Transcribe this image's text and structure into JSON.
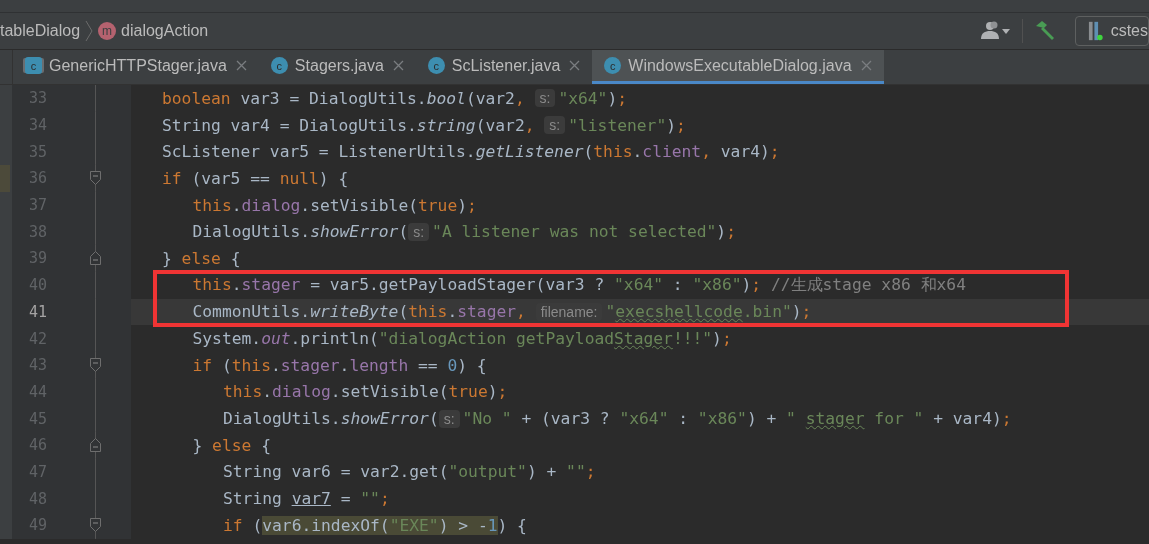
{
  "breadcrumb": {
    "items": [
      {
        "text": "tableDialog"
      },
      {
        "text": "dialogAction",
        "icon_letter": "m"
      }
    ]
  },
  "toolbar": {
    "run_config": "cstes"
  },
  "tabs": [
    {
      "label": "GenericHTTPStager.java",
      "icon_letter": "c",
      "kind": "decompiled",
      "selected": false
    },
    {
      "label": "Stagers.java",
      "icon_letter": "c",
      "kind": "class",
      "selected": false
    },
    {
      "label": "ScListener.java",
      "icon_letter": "c",
      "kind": "class",
      "selected": false
    },
    {
      "label": "WindowsExecutableDialog.java",
      "icon_letter": "c",
      "kind": "class",
      "selected": true
    }
  ],
  "editor": {
    "lines": [
      {
        "number": "33",
        "fold_start": false,
        "fold_end": false,
        "boxed": false,
        "current": false,
        "marker": false,
        "t": [
          {
            "kind": "kw",
            "text": "boolean"
          },
          {
            "kind": "p",
            "text": " var3 = DialogUtils."
          },
          {
            "kind": "it",
            "text": "bool"
          },
          {
            "kind": "p",
            "text": "(var2"
          },
          {
            "kind": "kw",
            "text": ", "
          },
          {
            "kind": "hint",
            "text": "s:"
          },
          {
            "kind": "str",
            "text": "\"x64\""
          },
          {
            "kind": "p",
            "text": ")"
          },
          {
            "kind": "kw",
            "text": ";"
          }
        ]
      },
      {
        "number": "34",
        "fold_start": false,
        "fold_end": false,
        "boxed": false,
        "current": false,
        "marker": false,
        "t": [
          {
            "kind": "p",
            "text": "String var4 = DialogUtils."
          },
          {
            "kind": "it",
            "text": "string"
          },
          {
            "kind": "p",
            "text": "(var2"
          },
          {
            "kind": "kw",
            "text": ", "
          },
          {
            "kind": "hint",
            "text": "s:"
          },
          {
            "kind": "str",
            "text": "\"listener\""
          },
          {
            "kind": "p",
            "text": ")"
          },
          {
            "kind": "kw",
            "text": ";"
          }
        ]
      },
      {
        "number": "35",
        "fold_start": false,
        "fold_end": false,
        "boxed": false,
        "current": false,
        "marker": false,
        "t": [
          {
            "kind": "p",
            "text": "ScListener var5 = ListenerUtils."
          },
          {
            "kind": "it",
            "text": "getListener"
          },
          {
            "kind": "p",
            "text": "("
          },
          {
            "kind": "kw",
            "text": "this"
          },
          {
            "kind": "p",
            "text": "."
          },
          {
            "kind": "f",
            "text": "client"
          },
          {
            "kind": "kw",
            "text": ", "
          },
          {
            "kind": "p",
            "text": "var4)"
          },
          {
            "kind": "kw",
            "text": ";"
          }
        ]
      },
      {
        "number": "36",
        "fold_start": true,
        "fold_end": false,
        "boxed": false,
        "current": false,
        "marker": true,
        "t": [
          {
            "kind": "kw",
            "text": "if"
          },
          {
            "kind": "p",
            "text": " (var5 == "
          },
          {
            "kind": "kw",
            "text": "null"
          },
          {
            "kind": "p",
            "text": ") {"
          }
        ],
        "children": [
          {
            "number": "37",
            "fold_start": false,
            "fold_end": false,
            "boxed": false,
            "current": false,
            "marker": false,
            "t": [
              {
                "kind": "kw",
                "text": "this"
              },
              {
                "kind": "p",
                "text": "."
              },
              {
                "kind": "f",
                "text": "dialog"
              },
              {
                "kind": "p",
                "text": ".setVisible("
              },
              {
                "kind": "kw",
                "text": "true"
              },
              {
                "kind": "p",
                "text": ")"
              },
              {
                "kind": "kw",
                "text": ";"
              }
            ]
          },
          {
            "number": "38",
            "fold_start": false,
            "fold_end": false,
            "boxed": false,
            "current": false,
            "marker": false,
            "t": [
              {
                "kind": "p",
                "text": "DialogUtils."
              },
              {
                "kind": "it",
                "text": "showError"
              },
              {
                "kind": "p",
                "text": "("
              },
              {
                "kind": "hint",
                "text": "s:"
              },
              {
                "kind": "str",
                "text": "\"A listener was not selected\""
              },
              {
                "kind": "p",
                "text": ")"
              },
              {
                "kind": "kw",
                "text": ";"
              }
            ]
          }
        ]
      },
      {
        "number": "39",
        "fold_start": false,
        "fold_end": true,
        "boxed": false,
        "current": false,
        "marker": false,
        "t": [
          {
            "kind": "p",
            "text": "} "
          },
          {
            "kind": "kw",
            "text": "else"
          },
          {
            "kind": "p",
            "text": " {"
          }
        ],
        "children": [
          {
            "number": "40",
            "fold_start": false,
            "fold_end": false,
            "boxed": true,
            "current": false,
            "marker": false,
            "t": [
              {
                "kind": "kw",
                "text": "this"
              },
              {
                "kind": "p",
                "text": "."
              },
              {
                "kind": "f",
                "text": "stager"
              },
              {
                "kind": "p",
                "text": " = var5.getPayloadStager(var3 ? "
              },
              {
                "kind": "str",
                "text": "\"x64\""
              },
              {
                "kind": "p",
                "text": " : "
              },
              {
                "kind": "str",
                "text": "\"x86\""
              },
              {
                "kind": "p",
                "text": ")"
              },
              {
                "kind": "kw",
                "text": ";"
              },
              {
                "kind": "cm",
                "text": " //生成stage x86 和x64"
              }
            ]
          },
          {
            "number": "41",
            "fold_start": false,
            "fold_end": false,
            "boxed": true,
            "current": true,
            "marker": false,
            "t": [
              {
                "kind": "p",
                "text": "CommonUtils."
              },
              {
                "kind": "it",
                "text": "writeByte"
              },
              {
                "kind": "p",
                "text": "("
              },
              {
                "kind": "kw",
                "text": "this"
              },
              {
                "kind": "p",
                "text": "."
              },
              {
                "kind": "f",
                "text": "stager"
              },
              {
                "kind": "kw",
                "text": ", "
              },
              {
                "kind": "hint",
                "text": "filename:"
              },
              {
                "kind": "str",
                "text": "\""
              },
              {
                "kind": "sw",
                "text": "execshellcode"
              },
              {
                "kind": "str",
                "text": ".bin\""
              },
              {
                "kind": "p",
                "text": ")"
              },
              {
                "kind": "kw",
                "text": ";"
              }
            ]
          },
          {
            "number": "42",
            "fold_start": false,
            "fold_end": false,
            "boxed": false,
            "current": false,
            "marker": false,
            "t": [
              {
                "kind": "p",
                "text": "System."
              },
              {
                "kind": "st",
                "text": "out"
              },
              {
                "kind": "p",
                "text": ".println("
              },
              {
                "kind": "str",
                "text": "\"dialogAction getPayload"
              },
              {
                "kind": "sw",
                "text": "Stager"
              },
              {
                "kind": "str",
                "text": "!!!\""
              },
              {
                "kind": "p",
                "text": ")"
              },
              {
                "kind": "kw",
                "text": ";"
              }
            ]
          },
          {
            "number": "43",
            "fold_start": true,
            "fold_end": false,
            "boxed": false,
            "current": false,
            "marker": false,
            "t": [
              {
                "kind": "kw",
                "text": "if"
              },
              {
                "kind": "p",
                "text": " ("
              },
              {
                "kind": "kw",
                "text": "this"
              },
              {
                "kind": "p",
                "text": "."
              },
              {
                "kind": "f",
                "text": "stager"
              },
              {
                "kind": "p",
                "text": "."
              },
              {
                "kind": "f",
                "text": "length"
              },
              {
                "kind": "p",
                "text": " == "
              },
              {
                "kind": "n",
                "text": "0"
              },
              {
                "kind": "p",
                "text": ") {"
              }
            ],
            "children": [
              {
                "number": "44",
                "fold_start": false,
                "fold_end": false,
                "boxed": false,
                "current": false,
                "marker": false,
                "t": [
                  {
                    "kind": "kw",
                    "text": "this"
                  },
                  {
                    "kind": "p",
                    "text": "."
                  },
                  {
                    "kind": "f",
                    "text": "dialog"
                  },
                  {
                    "kind": "p",
                    "text": ".setVisible("
                  },
                  {
                    "kind": "kw",
                    "text": "true"
                  },
                  {
                    "kind": "p",
                    "text": ")"
                  },
                  {
                    "kind": "kw",
                    "text": ";"
                  }
                ]
              },
              {
                "number": "45",
                "fold_start": false,
                "fold_end": false,
                "boxed": false,
                "current": false,
                "marker": false,
                "t": [
                  {
                    "kind": "p",
                    "text": "DialogUtils."
                  },
                  {
                    "kind": "it",
                    "text": "showError"
                  },
                  {
                    "kind": "p",
                    "text": "("
                  },
                  {
                    "kind": "hint",
                    "text": "s:"
                  },
                  {
                    "kind": "str",
                    "text": "\"No \""
                  },
                  {
                    "kind": "p",
                    "text": " + (var3 ? "
                  },
                  {
                    "kind": "str",
                    "text": "\"x64\""
                  },
                  {
                    "kind": "p",
                    "text": " : "
                  },
                  {
                    "kind": "str",
                    "text": "\"x86\""
                  },
                  {
                    "kind": "p",
                    "text": ") + "
                  },
                  {
                    "kind": "str",
                    "text": "\" "
                  },
                  {
                    "kind": "sw",
                    "text": "stager"
                  },
                  {
                    "kind": "str",
                    "text": " for \""
                  },
                  {
                    "kind": "p",
                    "text": " + var4)"
                  },
                  {
                    "kind": "kw",
                    "text": ";"
                  }
                ]
              }
            ]
          },
          {
            "number": "46",
            "fold_start": false,
            "fold_end": true,
            "boxed": false,
            "current": false,
            "marker": false,
            "t": [
              {
                "kind": "p",
                "text": "} "
              },
              {
                "kind": "kw",
                "text": "else"
              },
              {
                "kind": "p",
                "text": " {"
              }
            ],
            "children": [
              {
                "number": "47",
                "fold_start": false,
                "fold_end": false,
                "boxed": false,
                "current": false,
                "marker": false,
                "t": [
                  {
                    "kind": "p",
                    "text": "String var6 = var2.get("
                  },
                  {
                    "kind": "str",
                    "text": "\"output\""
                  },
                  {
                    "kind": "p",
                    "text": ") + "
                  },
                  {
                    "kind": "str",
                    "text": "\"\""
                  },
                  {
                    "kind": "kw",
                    "text": ";"
                  }
                ]
              },
              {
                "number": "48",
                "fold_start": false,
                "fold_end": false,
                "boxed": false,
                "current": false,
                "marker": false,
                "t": [
                  {
                    "kind": "p",
                    "text": "String "
                  },
                  {
                    "kind": "pu",
                    "text": "var7"
                  },
                  {
                    "kind": "p",
                    "text": " = "
                  },
                  {
                    "kind": "str",
                    "text": "\"\""
                  },
                  {
                    "kind": "kw",
                    "text": ";"
                  }
                ]
              },
              {
                "number": "49",
                "fold_start": true,
                "fold_end": false,
                "boxed": false,
                "current": false,
                "marker": false,
                "t": [
                  {
                    "kind": "kw",
                    "text": "if"
                  },
                  {
                    "kind": "p",
                    "text": " ("
                  },
                  {
                    "kind": "hl",
                    "text": "var6.indexOf("
                  },
                  {
                    "kind": "hls",
                    "text": "\"EXE\""
                  },
                  {
                    "kind": "hl",
                    "text": ") > -"
                  },
                  {
                    "kind": "hln",
                    "text": "1"
                  },
                  {
                    "kind": "p",
                    "text": ") {"
                  }
                ]
              }
            ]
          }
        ]
      }
    ]
  }
}
